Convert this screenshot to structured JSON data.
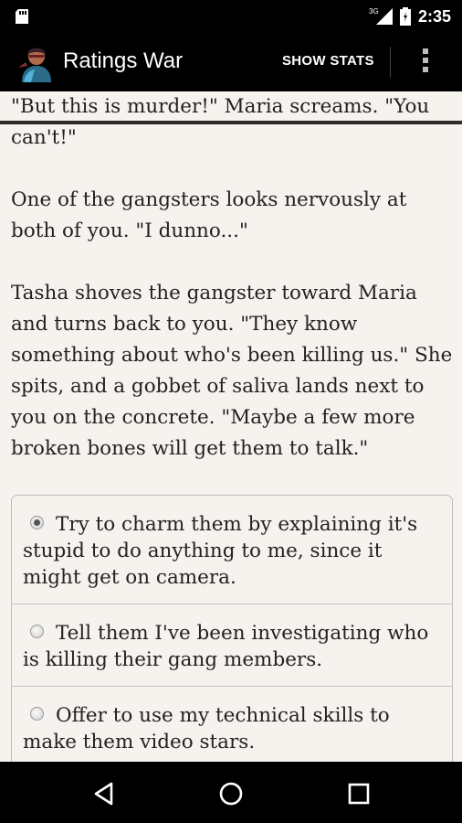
{
  "status_bar": {
    "time": "2:35",
    "network_label": "3G",
    "icons": [
      "sd-card-icon",
      "signal-icon",
      "battery-icon"
    ]
  },
  "app_bar": {
    "title": "Ratings War",
    "show_stats_label": "SHOW STATS",
    "icons": [
      "app-icon",
      "overflow-menu-icon"
    ]
  },
  "story": {
    "paragraphs": [
      "\"But this is murder!\" Maria screams. \"You can't!\"",
      "One of the gangsters looks nervously at both of you. \"I dunno...\"",
      "Tasha shoves the gangster toward Maria and turns back to you. \"They know something about who's been killing us.\" She spits, and a gobbet of saliva lands next to you on the concrete. \"Maybe a few more broken bones will get them to talk.\""
    ]
  },
  "choices": [
    {
      "label": "Try to charm them by explaining it's stupid to do anything to me, since it might get on camera.",
      "selected": true
    },
    {
      "label": "Tell them I've been investigating who is killing their gang members.",
      "selected": false
    },
    {
      "label": "Offer to use my technical skills to make them video stars.",
      "selected": false
    }
  ],
  "nav_bar": {
    "icons": [
      "back-icon",
      "home-icon",
      "recents-icon"
    ]
  }
}
